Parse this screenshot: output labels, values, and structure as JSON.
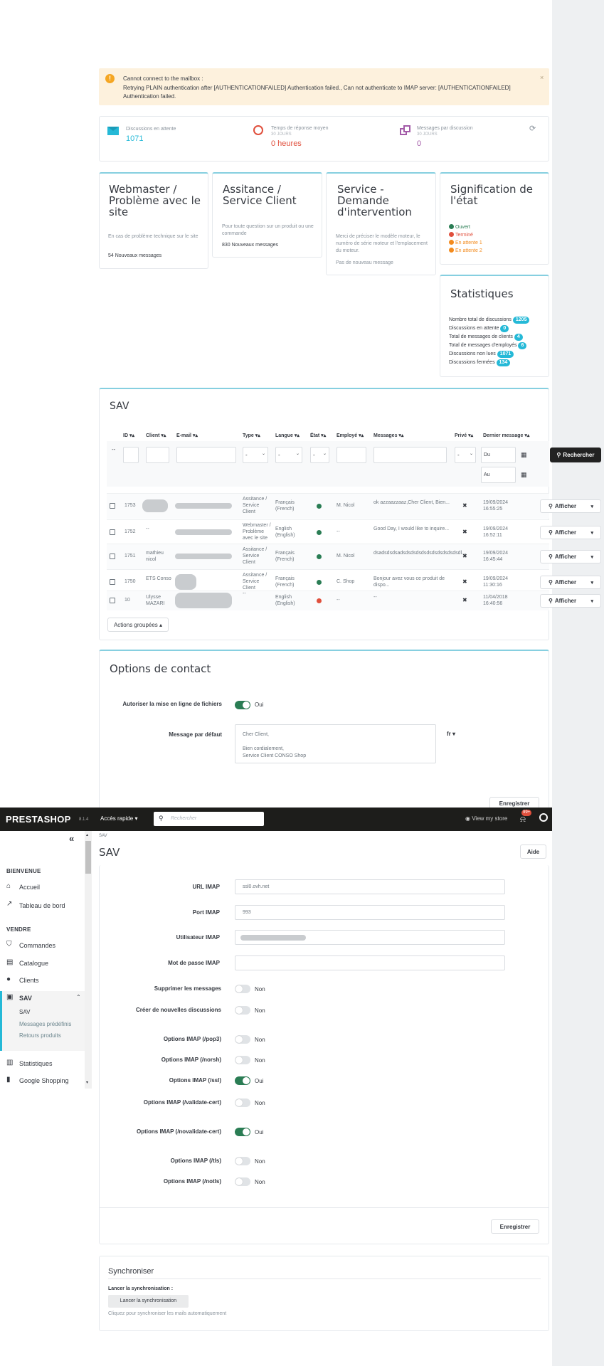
{
  "alert": {
    "title": "Cannot connect to the mailbox :",
    "message": "Retrying PLAIN authentication after [AUTHENTICATIONFAILED] Authentication failed., Can not authenticate to IMAP server: [AUTHENTICATIONFAILED] Authentication failed."
  },
  "kpis": [
    {
      "label": "Discussions en attente",
      "value": "1071",
      "sub": ""
    },
    {
      "label": "Temps de réponse moyen",
      "sub": "30 JOURS",
      "value": "0 heures"
    },
    {
      "label": "Messages par discussion",
      "sub": "30 JOURS",
      "value": "0"
    }
  ],
  "contacts": [
    {
      "title": "Webmaster / Problème avec le site",
      "desc": "En cas de problème technique sur le site",
      "count": "54 Nouveaux messages"
    },
    {
      "title": "Assitance / Service Client",
      "desc": "Pour toute question sur un produit ou une commande",
      "count": "830 Nouveaux messages"
    },
    {
      "title": "Service - Demande d'intervention",
      "desc": "Merci de préciser le modèle moteur, le numéro de série moteur et l'emplacement du moteur.",
      "count": "Pas de nouveau message"
    }
  ],
  "legend": {
    "title": "Signification de l'état",
    "items": [
      {
        "label": "Ouvert",
        "color": "#2a7d54"
      },
      {
        "label": "Terminé",
        "color": "#e04f3c"
      },
      {
        "label": "En attente 1",
        "color": "#f38b1e"
      },
      {
        "label": "En attente 2",
        "color": "#f38b1e"
      }
    ]
  },
  "stats": {
    "title": "Statistiques",
    "rows": [
      {
        "label": "Nombre total de discussions",
        "value": "1205"
      },
      {
        "label": "Discussions en attente",
        "value": "0"
      },
      {
        "label": "Total de messages de clients",
        "value": "4"
      },
      {
        "label": "Total de messages d'employés",
        "value": "6"
      },
      {
        "label": "Discussions non lues",
        "value": "1071"
      },
      {
        "label": "Discussions fermées",
        "value": "134"
      }
    ]
  },
  "sav": {
    "title": "SAV",
    "columns": [
      "ID",
      "Client",
      "E-mail",
      "Type",
      "Langue",
      "État",
      "Employé",
      "Messages",
      "Privé",
      "Dernier message"
    ],
    "filter": {
      "select": "-",
      "du": "Du",
      "au": "Au",
      "search_btn": "Rechercher"
    },
    "rows": [
      {
        "id": "1753",
        "client": "",
        "type": "Assitance / Service Client",
        "lang": "Français (French)",
        "state_color": "#2a7d54",
        "employee": "M. Nicol",
        "msg": "ok azzaazzaaz,Cher Client, Bien...",
        "private": "✖",
        "date": "19/09/2024 16:55:25",
        "action": "Afficher"
      },
      {
        "id": "1752",
        "client": "--",
        "type": "Webmaster / Problème avec le site",
        "lang": "English (English)",
        "state_color": "#2a7d54",
        "employee": "--",
        "msg": "Good Day, I would like to inquire...",
        "private": "✖",
        "date": "19/09/2024 16:52:11",
        "action": "Afficher"
      },
      {
        "id": "1751",
        "client": "mathieu nicol",
        "type": "Assitance / Service Client",
        "lang": "Français (French)",
        "state_color": "#2a7d54",
        "employee": "M. Nicol",
        "msg": "dsadsdsdsadsdsdsdsdsdsdsdsdsdsdsdl...",
        "private": "✖",
        "date": "19/09/2024 16:45:44",
        "action": "Afficher"
      },
      {
        "id": "1750",
        "client": "ETS Conso",
        "type": "Assitance / Service Client",
        "lang": "Français (French)",
        "state_color": "#2a7d54",
        "employee": "C. Shop",
        "msg": "Bonjour avez vous ce produit de dispo...",
        "private": "✖",
        "date": "19/09/2024 11:30:16",
        "action": "Afficher"
      },
      {
        "id": "10",
        "client": "Ulysse MAZARI",
        "type": "--",
        "lang": "English (English)",
        "state_color": "#e04f3c",
        "employee": "--",
        "msg": "--",
        "private": "✖",
        "date": "11/04/2018 16:40:56",
        "action": "Afficher"
      }
    ],
    "bulk": "Actions groupées ▴"
  },
  "options": {
    "title": "Options de contact",
    "upload_label": "Autoriser la mise en ligne de fichiers",
    "upload_value": "Oui",
    "default_msg_label": "Message par défaut",
    "default_msg_lines": [
      "Cher Client,",
      "",
      "Bien cordialement,",
      "Service Client CONSO Shop"
    ],
    "lang": "fr",
    "save": "Enregistrer"
  },
  "topbar": {
    "logo": "PRESTASHOP",
    "version": "8.1.4",
    "quick": "Accès rapide",
    "search_placeholder": "Rechercher",
    "view_store": "View my store",
    "notif_count": "99+"
  },
  "sidebar": {
    "collapse": "«",
    "sections": [
      "BIENVENUE",
      "VENDRE"
    ],
    "items": [
      {
        "label": "Accueil"
      },
      {
        "label": "Tableau de bord"
      },
      {
        "label": "Commandes"
      },
      {
        "label": "Catalogue"
      },
      {
        "label": "Clients"
      },
      {
        "label": "SAV"
      },
      {
        "label": "Statistiques"
      },
      {
        "label": "Google Shopping"
      }
    ],
    "sub": [
      "SAV",
      "Messages prédéfinis",
      "Retours produits"
    ]
  },
  "page": {
    "breadcrumb": "SAV",
    "title": "SAV",
    "help": "Aide"
  },
  "imap": {
    "fields": [
      {
        "label": "URL IMAP",
        "value": "ssl0.ovh.net"
      },
      {
        "label": "Port IMAP",
        "value": "993"
      },
      {
        "label": "Utilisateur IMAP",
        "value": ""
      },
      {
        "label": "Mot de passe IMAP",
        "value": ""
      }
    ],
    "toggles": [
      {
        "label": "Supprimer les messages",
        "value": "Non",
        "on": false
      },
      {
        "label": "Créer de nouvelles discussions",
        "value": "Non",
        "on": false
      },
      {
        "label": "Options IMAP (/pop3)",
        "value": "Non",
        "on": false
      },
      {
        "label": "Options IMAP (/norsh)",
        "value": "Non",
        "on": false
      },
      {
        "label": "Options IMAP (/ssl)",
        "value": "Oui",
        "on": true
      },
      {
        "label": "Options IMAP (/validate-cert)",
        "value": "Non",
        "on": false
      },
      {
        "label": "Options IMAP (/novalidate-cert)",
        "value": "Oui",
        "on": true
      },
      {
        "label": "Options IMAP (/tls)",
        "value": "Non",
        "on": false
      },
      {
        "label": "Options IMAP (/notls)",
        "value": "Non",
        "on": false
      }
    ],
    "save": "Enregistrer"
  },
  "sync": {
    "title": "Synchroniser",
    "label": "Lancer la synchronisation :",
    "button": "Lancer la synchronisation",
    "help": "Cliquez pour synchroniser les mails automatiquement"
  },
  "colors": {
    "accent": "#25b9d7",
    "topbar": "#1d1d1b",
    "green": "#2a7d54",
    "red": "#e04f3c",
    "orange": "#f38b1e"
  }
}
